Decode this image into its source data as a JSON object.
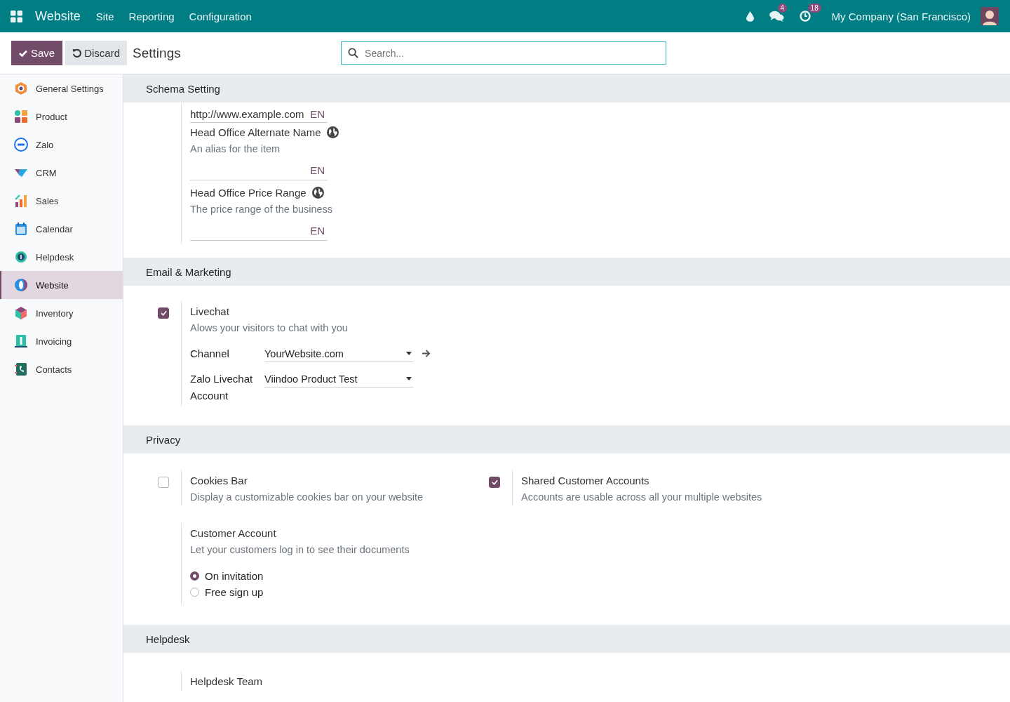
{
  "topbar": {
    "app": "Website",
    "menus": [
      "Site",
      "Reporting",
      "Configuration"
    ],
    "messages_count": "4",
    "activities_count": "18",
    "company": "My Company (San Francisco)"
  },
  "control": {
    "save": "Save",
    "discard": "Discard",
    "title": "Settings",
    "search_placeholder": "Search..."
  },
  "sidebar": {
    "items": [
      {
        "label": "General Settings",
        "selected": false
      },
      {
        "label": "Product",
        "selected": false
      },
      {
        "label": "Zalo",
        "selected": false
      },
      {
        "label": "CRM",
        "selected": false
      },
      {
        "label": "Sales",
        "selected": false
      },
      {
        "label": "Calendar",
        "selected": false
      },
      {
        "label": "Helpdesk",
        "selected": false
      },
      {
        "label": "Website",
        "selected": true
      },
      {
        "label": "Inventory",
        "selected": false
      },
      {
        "label": "Invoicing",
        "selected": false
      },
      {
        "label": "Contacts",
        "selected": false
      }
    ]
  },
  "sections": [
    {
      "title": "Schema Setting",
      "settings": [
        {
          "kind": "translatable",
          "top_value": "http://www.example.com",
          "top_lang": "EN",
          "label": "Head Office Alternate Name",
          "description": "An alias for the item",
          "lang": "EN"
        },
        {
          "kind": "translatable",
          "label": "Head Office Price Range",
          "description": "The price range of the business",
          "lang": "EN"
        }
      ]
    },
    {
      "title": "Email & Marketing",
      "settings": [
        {
          "kind": "checkbox",
          "checked": true,
          "label": "Livechat",
          "description": "Alows your visitors to chat with you",
          "fields": [
            {
              "label": "Channel",
              "value": "YourWebsite.com"
            },
            {
              "label": "Zalo Livechat Account",
              "value": "Viindoo Product Test"
            }
          ]
        }
      ]
    },
    {
      "title": "Privacy",
      "settings": [
        {
          "kind": "checkbox",
          "checked": false,
          "label": "Cookies Bar",
          "description": "Display a customizable cookies bar on your website"
        },
        {
          "kind": "checkbox",
          "checked": true,
          "label": "Shared Customer Accounts",
          "description": "Accounts are usable across all your multiple websites"
        },
        {
          "kind": "radio",
          "label": "Customer Account",
          "description": "Let your customers log in to see their documents",
          "options": [
            {
              "label": "On invitation",
              "selected": true
            },
            {
              "label": "Free sign up",
              "selected": false
            }
          ]
        }
      ]
    },
    {
      "title": "Helpdesk",
      "settings": [
        {
          "kind": "plain",
          "label": "Helpdesk Team"
        }
      ]
    }
  ]
}
